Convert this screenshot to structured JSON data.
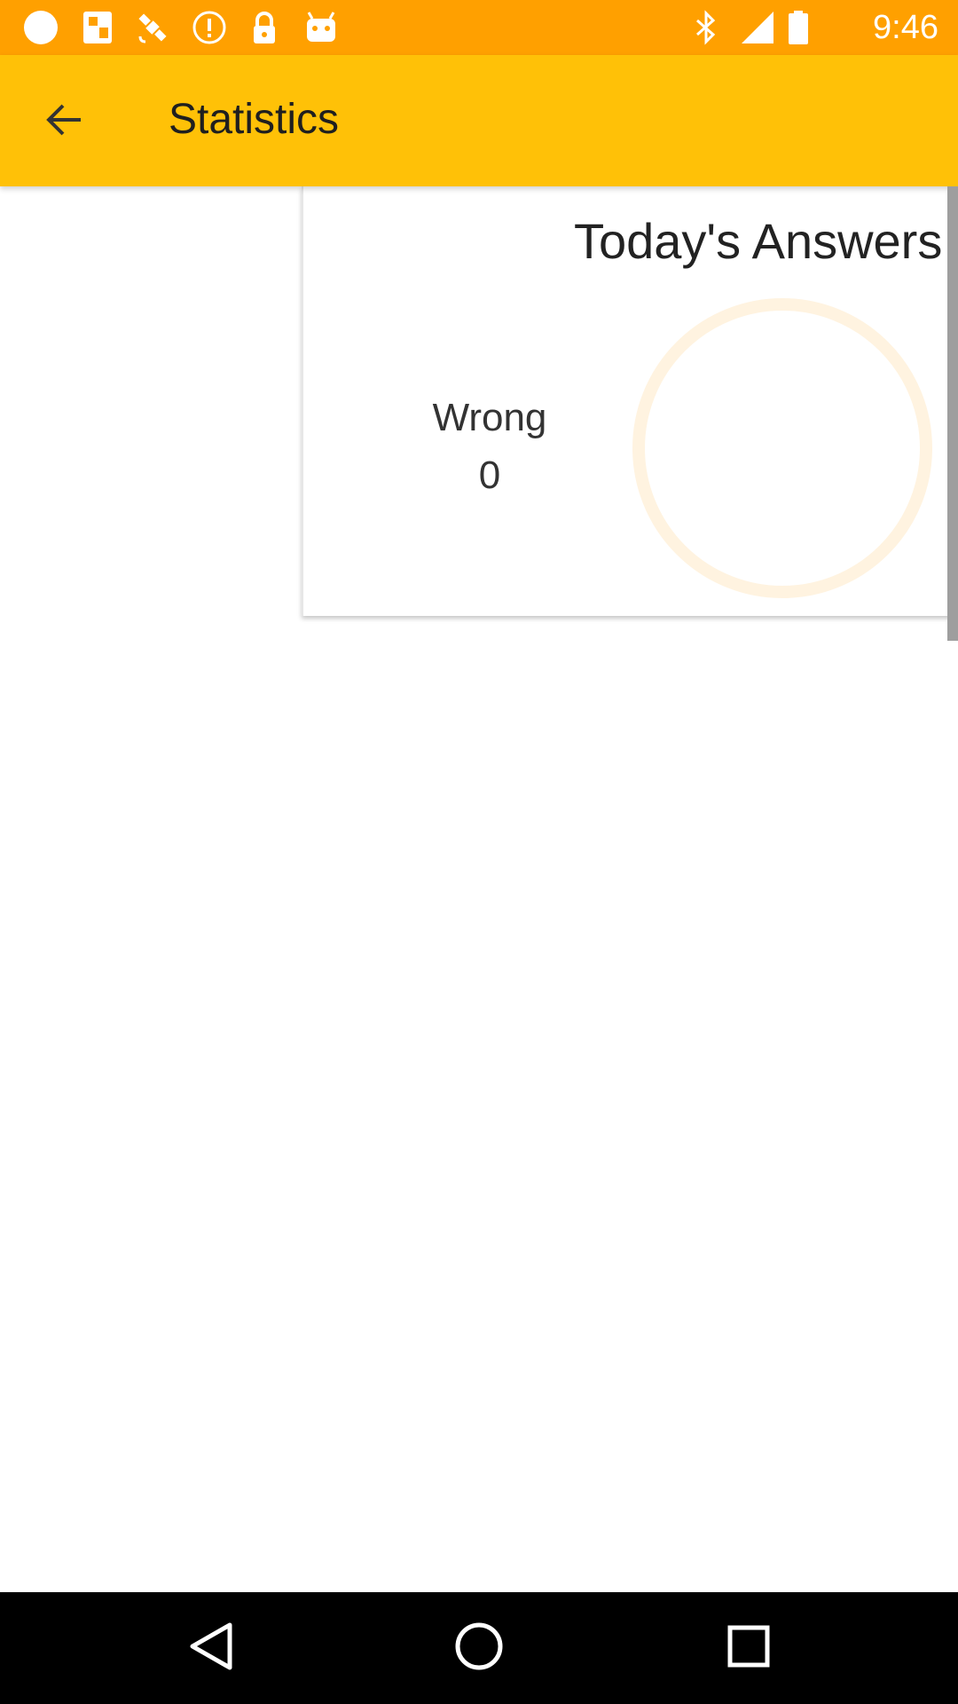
{
  "status_bar": {
    "time": "9:46",
    "left_icons": [
      "circle-icon",
      "fake-gps-icon",
      "satellite-icon",
      "info-circle-icon",
      "lock-icon",
      "android-icon"
    ],
    "right_icons": [
      "bluetooth-icon",
      "signal-icon",
      "battery-icon"
    ],
    "background": "#FFA000"
  },
  "app_bar": {
    "title": "Statistics",
    "background": "#FFC107"
  },
  "card": {
    "title": "Today's Answers",
    "legend_label": "Wrong",
    "legend_value": "0",
    "donut_color": "#FFF3E0"
  },
  "nav_bar": {
    "buttons": [
      "back-triangle-icon",
      "home-circle-icon",
      "recents-square-icon"
    ]
  }
}
